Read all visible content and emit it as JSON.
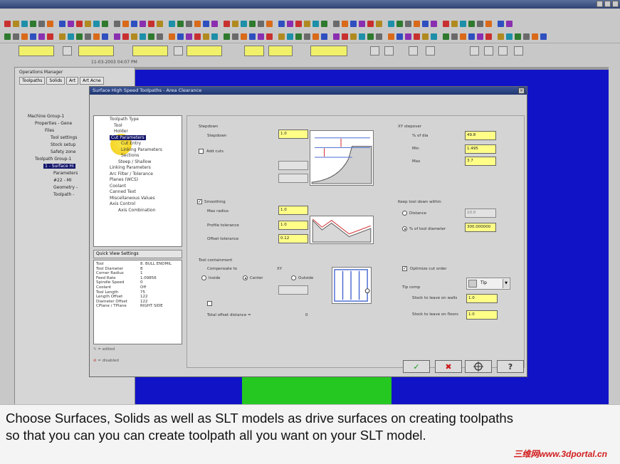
{
  "status": {
    "date": "11-03-2003 04:07 PM"
  },
  "ops_manager": {
    "title": "Operations Manager",
    "tabs": [
      "Toolpaths",
      "Solids",
      "Art",
      "Art Acne"
    ],
    "tree": [
      "Machine Group-1",
      "Properties - Gene",
      "Files",
      "Tool settings",
      "Stock setup",
      "Safety zone",
      "Toolpath Group-1",
      "1 - Surface Hi",
      "Parameters",
      "#22 - MI",
      "Geometry -",
      "Toolpath -"
    ]
  },
  "dialog": {
    "title": "Surface High Speed Toolpaths - Area Clearance",
    "tree": [
      "Toolpath Type",
      "Tool",
      "Holder",
      "Cut Parameters",
      "Cut Entry",
      "Linking Parameters",
      "Sections",
      "Steep / Shallow",
      "Linking Parameters",
      "Arc Filter / Tolerance",
      "Planes (WCS)",
      "Coolant",
      "Canned Text",
      "Miscellaneous Values",
      "Axis Control",
      "Axis Combination"
    ],
    "quick_view_title": "Quick View Settings",
    "quick_view": [
      {
        "k": "Tool",
        "v": "8. BULL ENDMIL"
      },
      {
        "k": "Tool Diameter",
        "v": "8"
      },
      {
        "k": "Corner Radius",
        "v": "1"
      },
      {
        "k": "Feed Rate",
        "v": "1.09856"
      },
      {
        "k": "Spindle Speed",
        "v": "0"
      },
      {
        "k": "Coolant",
        "v": "Off"
      },
      {
        "k": "Tool Length",
        "v": "75"
      },
      {
        "k": "Length Offset",
        "v": "122"
      },
      {
        "k": "Diameter Offset",
        "v": "122"
      },
      {
        "k": "CPlane / TPlane",
        "v": "RIGHT SIDE"
      }
    ],
    "legend": {
      "edited": "= edited",
      "disabled": "= disabled"
    },
    "stepdown": {
      "title": "Stepdown",
      "label": "Stepdown",
      "value": "1.0",
      "add_cuts": "Add cuts"
    },
    "xy_stepover": {
      "title": "XY stepover",
      "pct_label": "% of dia",
      "pct_value": "49.8",
      "min_label": "Min",
      "min_value": "1.495",
      "max_label": "Max",
      "max_value": "3.7"
    },
    "smoothing": {
      "title": "Smoothing",
      "max_radius_label": "Max radius",
      "max_radius": "1.0",
      "profile_tol_label": "Profile tolerance",
      "profile_tol": "1.0",
      "offset_tol_label": "Offset tolerance",
      "offset_tol": "0.12"
    },
    "keep_down": {
      "title": "Keep tool down within",
      "distance_label": "Distance",
      "distance_value": "10.0",
      "pct_label": "% of tool diameter",
      "pct_value": "300.000000"
    },
    "containment": {
      "title": "Tool containment",
      "compensate_label": "Compensate to",
      "xy_label": "XY",
      "inside": "Inside",
      "center": "Center",
      "outside": "Outside",
      "total_offset_label": "Total offset distance =",
      "total_offset_value": "0"
    },
    "right_opts": {
      "optimize": "Optimize cut order",
      "tip_comp_label": "Tip comp",
      "tip_comp_value": "Tip",
      "walls_label": "Stock to leave on walls",
      "walls_value": "1.0",
      "floors_label": "Stock to leave on floors",
      "floors_value": "1.0"
    },
    "buttons": {
      "ok": "✓",
      "cancel": "✖",
      "help": "?"
    }
  },
  "caption": {
    "line1": "Choose Surfaces, Solids as well as SLT models as drive surfaces on creating toolpaths",
    "line2": "so that you can you can create toolpath all you want on your SLT model.",
    "watermark": "三维网www.3dportal.cn"
  }
}
